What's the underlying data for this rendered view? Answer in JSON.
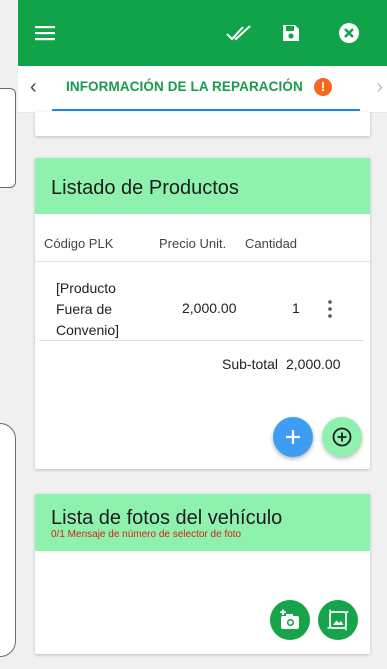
{
  "toolbar": {
    "menu_icon": "menu-icon",
    "actions": [
      "double-check-icon",
      "save-icon",
      "close-circle-icon"
    ],
    "color": "#11a34a"
  },
  "tabs": {
    "active_label": "INFORMACIÓN DE LA REPARACIÓN",
    "badge": "!",
    "prev_arrow": "‹",
    "next_arrow": "›",
    "active_color": "#1a9b4a",
    "badge_color": "#f26a22",
    "underline_color": "#1e88e5"
  },
  "products": {
    "title": "Listado de Productos",
    "columns": [
      "Código PLK",
      "Precio Unit.",
      "Cantidad"
    ],
    "rows": [
      {
        "code_lines": [
          "[Producto",
          "Fuera de",
          "Convenio]"
        ],
        "price": "2,000.00",
        "quantity": "1"
      }
    ],
    "subtotal_label": "Sub-total",
    "subtotal_value": "2,000.00",
    "header_color": "#8ff1ae",
    "add_button_icon": "plus-icon",
    "add_circle_button_icon": "plus-circle-icon"
  },
  "photos": {
    "title": "Lista de fotos del vehículo",
    "subtitle": "0/1 Mensaje de número de selector de foto",
    "camera_button_icon": "add-camera-icon",
    "gallery_button_icon": "gallery-icon"
  }
}
